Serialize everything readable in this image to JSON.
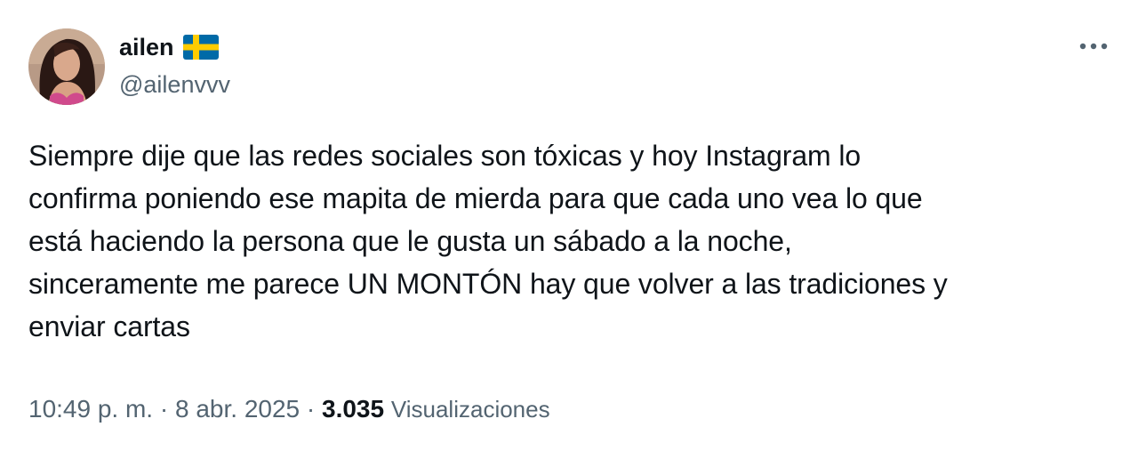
{
  "user": {
    "display_name": "ailen",
    "flag_icon": "sweden-flag-icon",
    "handle": "@ailenvvv"
  },
  "more_icon": "more-options-icon",
  "tweet": {
    "text": "Siempre dije que las redes sociales son tóxicas y hoy Instagram lo\nconfirma poniendo ese mapita de mierda para que cada uno vea lo que\nestá haciendo la persona que le gusta un sábado a la noche,\nsinceramente me parece UN MONTÓN hay que volver a las tradiciones y\nenviar cartas"
  },
  "meta": {
    "time": "10:49 p. m.",
    "separator1": " · ",
    "date": "8 abr. 2025",
    "separator2": " · ",
    "views_count": "3.035",
    "views_label": "Visualizaciones"
  },
  "colors": {
    "text": "#0f1419",
    "secondary": "#536471",
    "flag_blue": "#006aa7",
    "flag_yellow": "#fecc00"
  }
}
